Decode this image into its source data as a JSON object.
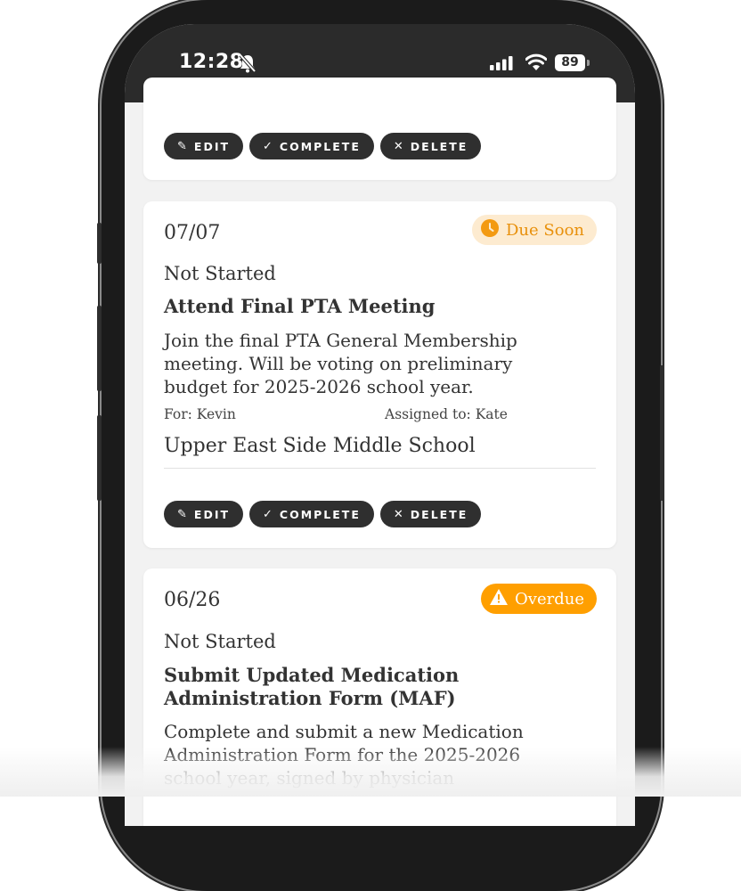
{
  "status_bar": {
    "time": "12:28",
    "battery": "89"
  },
  "cards": [
    {
      "actions": {
        "edit": "EDIT",
        "complete": "COMPLETE",
        "delete": "DELETE"
      }
    },
    {
      "date": "07/07",
      "badge": "Due Soon",
      "badge_color": "#e8900b",
      "status": "Not Started",
      "title": "Attend Final PTA Meeting",
      "description": "Join the final PTA General Membership meeting. Will be voting on preliminary budget for 2025-2026 school year.",
      "for": "For: Kevin",
      "assigned": "Assigned to: Kate",
      "school": "Upper East Side Middle School",
      "actions": {
        "edit": "EDIT",
        "complete": "COMPLETE",
        "delete": "DELETE"
      }
    },
    {
      "date": "06/26",
      "badge": "Overdue",
      "badge_color": "#ff9f00",
      "status": "Not Started",
      "title": "Submit Updated Medication Administration Form (MAF)",
      "description": "Complete and submit a new Medication Administration Form for the 2025-2026 school year, signed by physician"
    }
  ]
}
